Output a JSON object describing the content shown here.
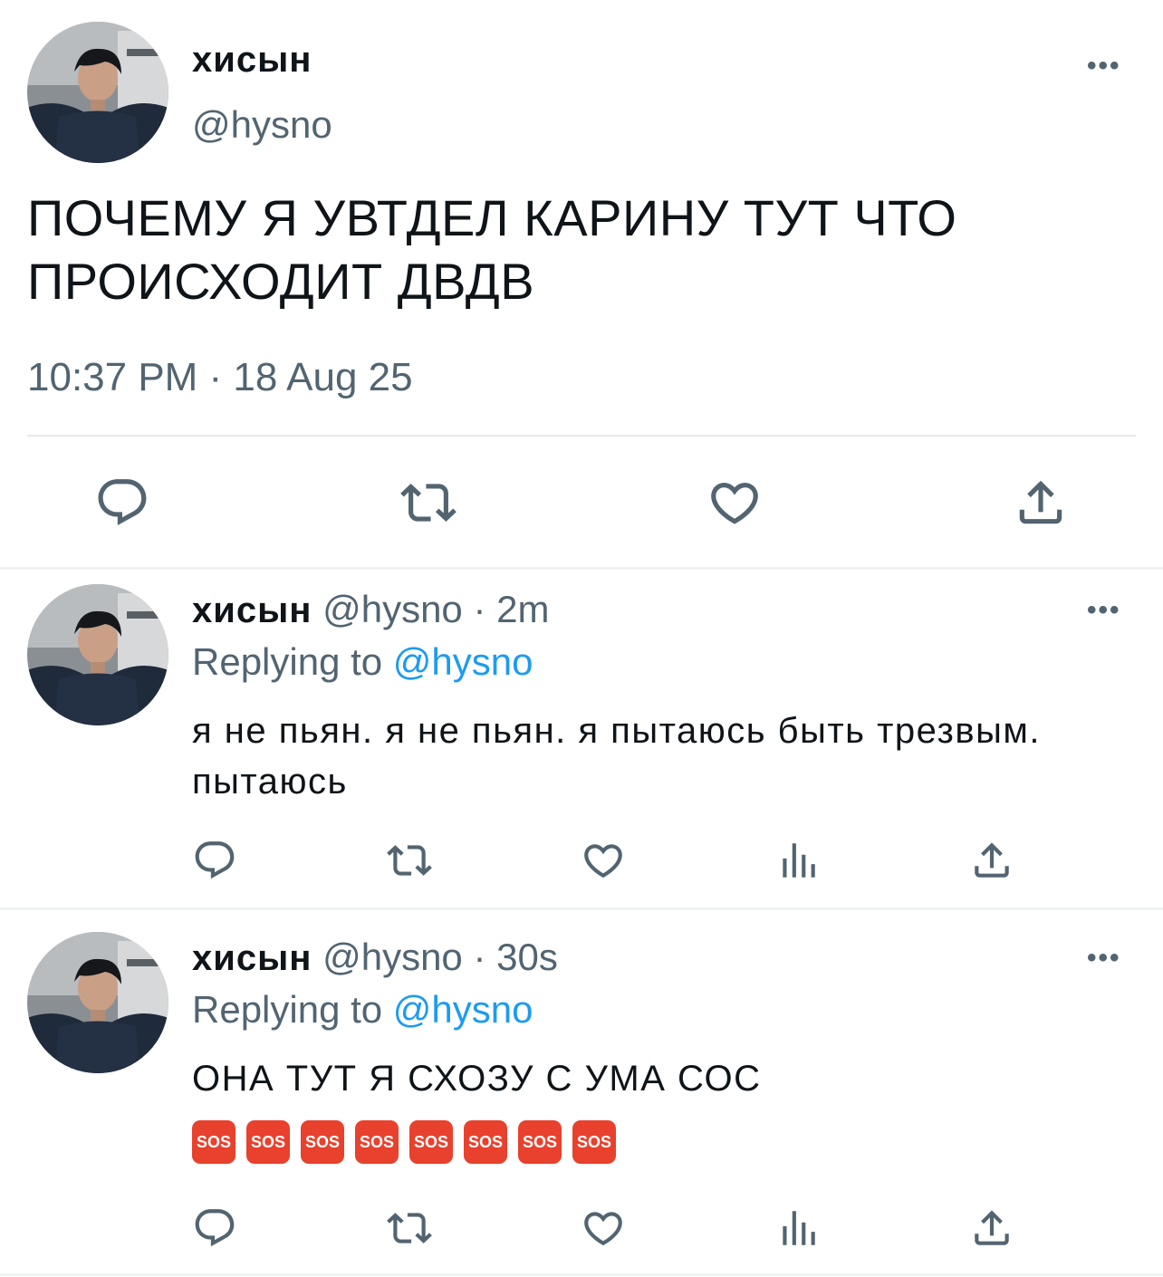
{
  "main_tweet": {
    "display_name": "хисын",
    "handle": "@hysno",
    "text": "ПОЧЕМУ Я УВТДЕЛ КАРИНУ ТУТ ЧТО ПРОИСХОДИТ ДВДВ",
    "timestamp": "10:37 PM · 18 Aug 25",
    "more_icon": "•••",
    "actions": [
      "reply-icon",
      "retweet-icon",
      "like-icon",
      "share-icon"
    ]
  },
  "replies": [
    {
      "display_name": "хисын",
      "handle_time": " @hysno · 2m",
      "replying_prefix": "Replying to ",
      "replying_mention": "@hysno",
      "text": "я не пьян. я не пьян. я пытаюсь быть трезвым. пытаюсь",
      "more_icon": "•••",
      "actions": [
        "reply-icon",
        "retweet-icon",
        "like-icon",
        "analytics-icon",
        "share-icon"
      ]
    },
    {
      "display_name": "хисын",
      "handle_time": " @hysno · 30s",
      "replying_prefix": "Replying to ",
      "replying_mention": "@hysno",
      "text": "ОНА ТУТ Я СХОЗУ С УМА СОС",
      "emoji": [
        "SOS",
        "SOS",
        "SOS",
        "SOS",
        "SOS",
        "SOS",
        "SOS",
        "SOS"
      ],
      "more_icon": "•••",
      "actions": [
        "reply-icon",
        "retweet-icon",
        "like-icon",
        "analytics-icon",
        "share-icon"
      ]
    }
  ],
  "colors": {
    "text": "#0f1419",
    "secondary": "#536471",
    "link": "#1d9bf0",
    "divider": "#eff3f4",
    "sos": "#e8412d"
  }
}
